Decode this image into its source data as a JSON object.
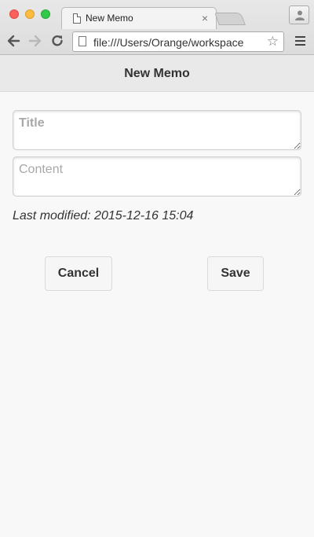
{
  "browser": {
    "tab_title": "New Memo",
    "tab_close": "×",
    "url": "file:///Users/Orange/workspace",
    "star": "☆"
  },
  "app": {
    "title": "New Memo"
  },
  "form": {
    "title_placeholder": "Title",
    "title_value": "",
    "content_placeholder": "Content",
    "content_value": "",
    "last_modified": "Last modified: 2015-12-16 15:04"
  },
  "actions": {
    "cancel_label": "Cancel",
    "save_label": "Save"
  },
  "colors": {
    "page_background": "#f8f8f8",
    "header_background": "#e9e9e9",
    "close_light": "#fc605c",
    "minimize_light": "#fdbc40",
    "zoom_light": "#34c84a"
  },
  "icons": [
    "page-icon",
    "close-icon",
    "user-icon",
    "back-arrow-icon",
    "forward-arrow-icon",
    "reload-icon",
    "star-icon",
    "hamburger-menu-icon"
  ]
}
